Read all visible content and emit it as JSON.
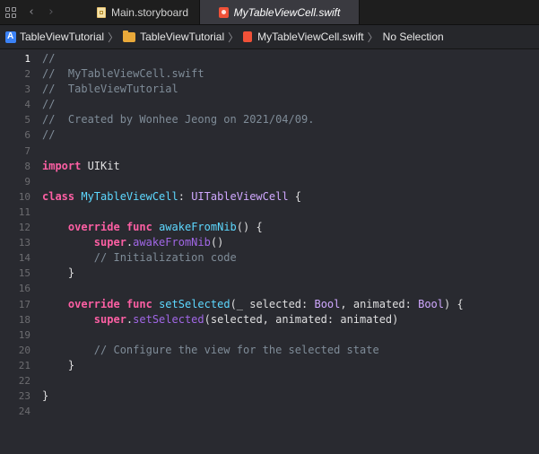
{
  "tabs": {
    "tab1_label": "Main.storyboard",
    "tab2_label": "MyTableViewCell.swift"
  },
  "jumpbar": {
    "project": "TableViewTutorial",
    "group": "TableViewTutorial",
    "file": "MyTableViewCell.swift",
    "selection": "No Selection"
  },
  "editor": {
    "current_line": 1,
    "lines": [
      {
        "n": "1",
        "tokens": [
          {
            "t": "//",
            "c": "comment"
          }
        ]
      },
      {
        "n": "2",
        "tokens": [
          {
            "t": "//  MyTableViewCell.swift",
            "c": "comment"
          }
        ]
      },
      {
        "n": "3",
        "tokens": [
          {
            "t": "//  TableViewTutorial",
            "c": "comment"
          }
        ]
      },
      {
        "n": "4",
        "tokens": [
          {
            "t": "//",
            "c": "comment"
          }
        ]
      },
      {
        "n": "5",
        "tokens": [
          {
            "t": "//  Created by Wonhee Jeong on 2021/04/09.",
            "c": "comment"
          }
        ]
      },
      {
        "n": "6",
        "tokens": [
          {
            "t": "//",
            "c": "comment"
          }
        ]
      },
      {
        "n": "7",
        "tokens": []
      },
      {
        "n": "8",
        "tokens": [
          {
            "t": "import",
            "c": "kw"
          },
          {
            "t": " UIKit",
            "c": "plain"
          }
        ]
      },
      {
        "n": "9",
        "tokens": []
      },
      {
        "n": "10",
        "tokens": [
          {
            "t": "class",
            "c": "kw"
          },
          {
            "t": " ",
            "c": "plain"
          },
          {
            "t": "MyTableViewCell",
            "c": "decl"
          },
          {
            "t": ": ",
            "c": "plain"
          },
          {
            "t": "UITableViewCell",
            "c": "type"
          },
          {
            "t": " {",
            "c": "plain"
          }
        ]
      },
      {
        "n": "11",
        "tokens": []
      },
      {
        "n": "12",
        "tokens": [
          {
            "t": "    ",
            "c": "plain"
          },
          {
            "t": "override",
            "c": "kw"
          },
          {
            "t": " ",
            "c": "plain"
          },
          {
            "t": "func",
            "c": "kw"
          },
          {
            "t": " ",
            "c": "plain"
          },
          {
            "t": "awakeFromNib",
            "c": "decl"
          },
          {
            "t": "() {",
            "c": "plain"
          }
        ]
      },
      {
        "n": "13",
        "tokens": [
          {
            "t": "        ",
            "c": "plain"
          },
          {
            "t": "super",
            "c": "kw"
          },
          {
            "t": ".",
            "c": "plain"
          },
          {
            "t": "awakeFromNib",
            "c": "fn"
          },
          {
            "t": "()",
            "c": "plain"
          }
        ]
      },
      {
        "n": "14",
        "tokens": [
          {
            "t": "        ",
            "c": "plain"
          },
          {
            "t": "// Initialization code",
            "c": "comment"
          }
        ]
      },
      {
        "n": "15",
        "tokens": [
          {
            "t": "    }",
            "c": "plain"
          }
        ]
      },
      {
        "n": "16",
        "tokens": []
      },
      {
        "n": "17",
        "tokens": [
          {
            "t": "    ",
            "c": "plain"
          },
          {
            "t": "override",
            "c": "kw"
          },
          {
            "t": " ",
            "c": "plain"
          },
          {
            "t": "func",
            "c": "kw"
          },
          {
            "t": " ",
            "c": "plain"
          },
          {
            "t": "setSelected",
            "c": "decl"
          },
          {
            "t": "(_ selected: ",
            "c": "plain"
          },
          {
            "t": "Bool",
            "c": "type"
          },
          {
            "t": ", animated: ",
            "c": "plain"
          },
          {
            "t": "Bool",
            "c": "type"
          },
          {
            "t": ") {",
            "c": "plain"
          }
        ]
      },
      {
        "n": "18",
        "tokens": [
          {
            "t": "        ",
            "c": "plain"
          },
          {
            "t": "super",
            "c": "kw"
          },
          {
            "t": ".",
            "c": "plain"
          },
          {
            "t": "setSelected",
            "c": "fn"
          },
          {
            "t": "(selected, animated: animated)",
            "c": "plain"
          }
        ]
      },
      {
        "n": "19",
        "tokens": []
      },
      {
        "n": "20",
        "tokens": [
          {
            "t": "        ",
            "c": "plain"
          },
          {
            "t": "// Configure the view for the selected state",
            "c": "comment"
          }
        ]
      },
      {
        "n": "21",
        "tokens": [
          {
            "t": "    }",
            "c": "plain"
          }
        ]
      },
      {
        "n": "22",
        "tokens": []
      },
      {
        "n": "23",
        "tokens": [
          {
            "t": "}",
            "c": "plain"
          }
        ]
      },
      {
        "n": "24",
        "tokens": []
      }
    ]
  }
}
